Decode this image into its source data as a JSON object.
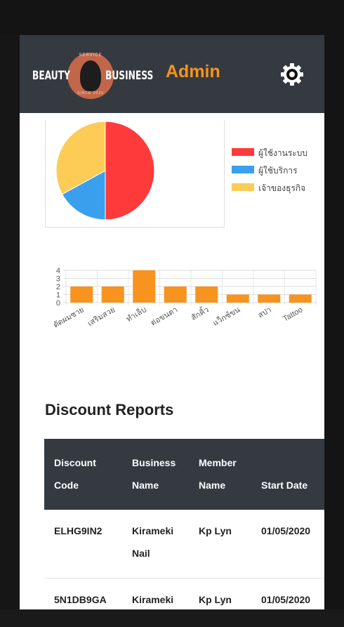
{
  "header": {
    "logo_left": "BEAUTY",
    "logo_right": "BUSINESS",
    "logo_top": "SERVICE",
    "logo_bottom": "SINCE 2020",
    "title": "Admin",
    "settings_icon": "gear-icon"
  },
  "pie_chart": {
    "legend": [
      {
        "label": "ผู้ใช้งานระบบ",
        "color": "#ff3a3a"
      },
      {
        "label": "ผู้ใช้บริการ",
        "color": "#3aa0ee"
      },
      {
        "label": "เจ้าของธุรกิจ",
        "color": "#fdcc57"
      }
    ]
  },
  "chart_data": [
    {
      "type": "pie",
      "labels": [
        "ผู้ใช้งานระบบ",
        "ผู้ใช้บริการ",
        "เจ้าของธุรกิจ"
      ],
      "values": [
        50,
        17,
        33
      ],
      "colors": [
        "#ff3a3a",
        "#3aa0ee",
        "#fdcc57"
      ],
      "legend": "right"
    },
    {
      "type": "bar",
      "categories": [
        "ตัดผมชาย",
        "เสริมสวย",
        "ทำเล็บ",
        "ต่อขนตา",
        "สักคิ้ว",
        "แว็กซ์ขน",
        "สปา",
        "Tattoo"
      ],
      "values": [
        2,
        2,
        4,
        2,
        2,
        1,
        1,
        1
      ],
      "yticks": [
        "4",
        "3",
        "2",
        "1",
        "0"
      ],
      "ylim": [
        0,
        4
      ],
      "color": "#f7931e",
      "grid": true
    }
  ],
  "discount": {
    "title": "Discount Reports",
    "headers": [
      [
        "Discount",
        "Code"
      ],
      [
        "Business",
        "Name"
      ],
      [
        "Member",
        "Name"
      ],
      [
        "",
        "Start Date"
      ]
    ],
    "rows": [
      {
        "code": "ELHG9IN2",
        "business": [
          "Kirameki",
          "Nail"
        ],
        "member": "Kp Lyn",
        "start": "01/05/2020"
      },
      {
        "code": "5N1DB9GA",
        "business": [
          "Kirameki",
          ""
        ],
        "member": "Kp Lyn",
        "start": "01/05/2020"
      }
    ]
  }
}
